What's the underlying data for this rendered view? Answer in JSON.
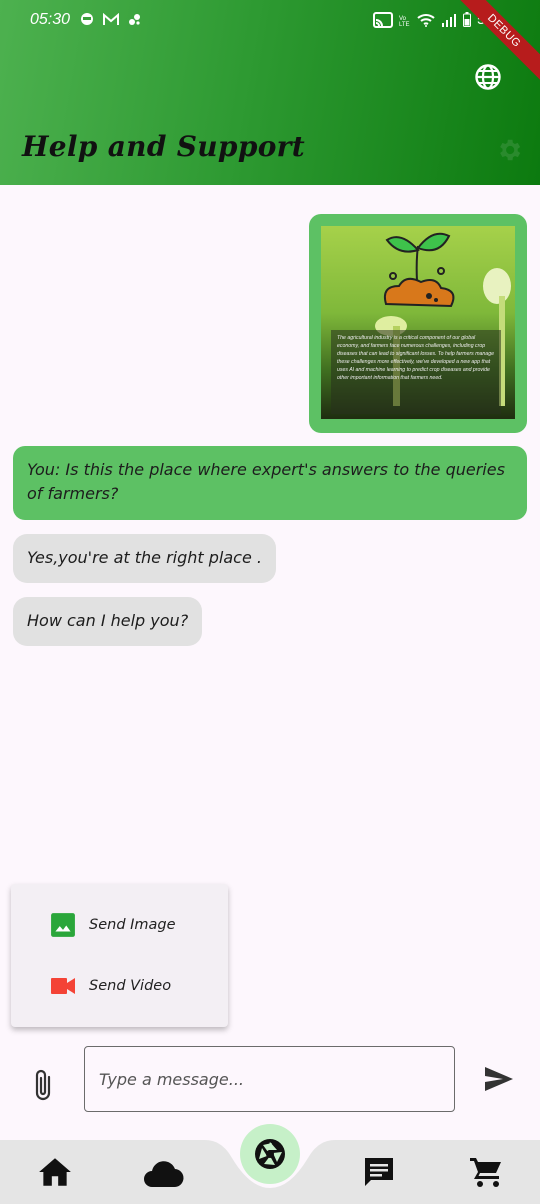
{
  "status_bar": {
    "time": "05:30",
    "battery": "50",
    "debug_label": "DEBUG"
  },
  "header": {
    "title": "Help and Support",
    "globe_icon": "globe-icon",
    "settings_icon": "settings-icon"
  },
  "image_message": {
    "promo_text": "The agricultural industry is a critical component of our global economy, and farmers face numerous challenges, including crop diseases that can lead to significant losses. To help farmers manage these challenges more effectively, we've developed a new app that uses AI and machine learning to predict crop diseases and provide other important information that farmers need."
  },
  "messages": [
    {
      "sender": "user",
      "text": "You: Is this the place where expert's answers to the queries of farmers?"
    },
    {
      "sender": "bot",
      "text": "Yes,you're at the right place ."
    },
    {
      "sender": "bot",
      "text": "How can I help you?"
    }
  ],
  "attach_menu": {
    "items": [
      {
        "label": "Send Image",
        "icon": "image-icon",
        "color": "#2aa63a"
      },
      {
        "label": "Send Video",
        "icon": "videocam-icon",
        "color": "#f44336"
      }
    ]
  },
  "composer": {
    "placeholder": "Type a message...",
    "value": ""
  },
  "bottom_nav": {
    "items": [
      "home-icon",
      "cloud-icon",
      "camera-icon",
      "chat-icon",
      "cart-icon"
    ],
    "background": "#e5e5e5",
    "fab_color": "#c6f0c8"
  },
  "colors": {
    "header_start": "#4db14f",
    "header_end": "#0c7a0f",
    "user_bubble": "#5dc164",
    "bot_bubble": "#e1e1e1"
  }
}
